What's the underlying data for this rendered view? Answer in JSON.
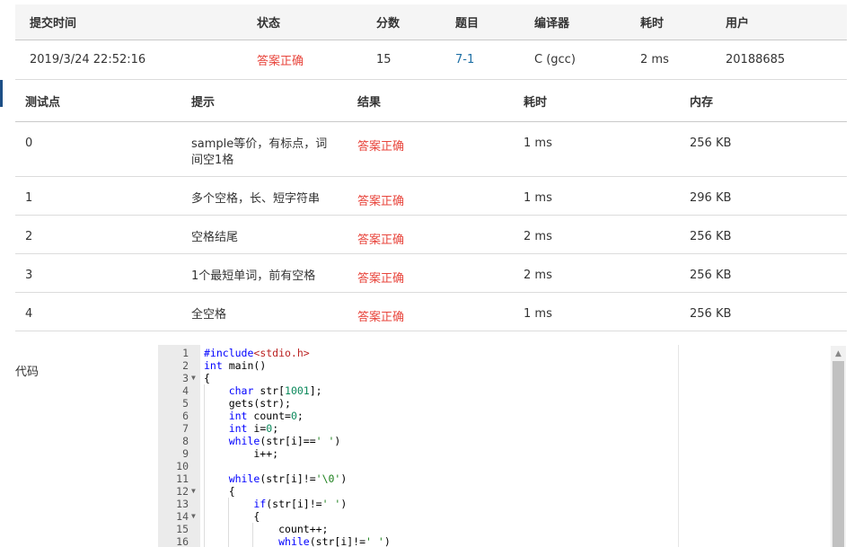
{
  "submission": {
    "headers": [
      "提交时间",
      "状态",
      "分数",
      "题目",
      "编译器",
      "耗时",
      "用户"
    ],
    "row": {
      "time": "2019/3/24 22:52:16",
      "status": "答案正确",
      "score": "15",
      "problem": "7-1",
      "compiler": "C (gcc)",
      "elapsed": "2 ms",
      "user": "20188685"
    }
  },
  "testcases": {
    "headers": [
      "测试点",
      "提示",
      "结果",
      "耗时",
      "内存"
    ],
    "rows": [
      {
        "id": "0",
        "hint": "sample等价，有标点，词间空1格",
        "result": "答案正确",
        "time": "1 ms",
        "mem": "256 KB"
      },
      {
        "id": "1",
        "hint": "多个空格，长、短字符串",
        "result": "答案正确",
        "time": "1 ms",
        "mem": "296 KB"
      },
      {
        "id": "2",
        "hint": "空格结尾",
        "result": "答案正确",
        "time": "2 ms",
        "mem": "256 KB"
      },
      {
        "id": "3",
        "hint": "1个最短单词，前有空格",
        "result": "答案正确",
        "time": "2 ms",
        "mem": "256 KB"
      },
      {
        "id": "4",
        "hint": "全空格",
        "result": "答案正确",
        "time": "1 ms",
        "mem": "256 KB"
      }
    ]
  },
  "code_section": {
    "label": "代码",
    "lines": [
      "#include<stdio.h>",
      "int main()",
      "{",
      "    char str[1001];",
      "    gets(str);",
      "    int count=0;",
      "    int i=0;",
      "    while(str[i]==' ')",
      "        i++;",
      "",
      "    while(str[i]!='\\0')",
      "    {",
      "        if(str[i]!=' ')",
      "        {",
      "            count++;",
      "            while(str[i]!=' ')"
    ],
    "fold_lines": [
      3,
      12,
      14
    ],
    "fold_icon": "fold-arrow-icon"
  },
  "scrollbar": {
    "up_icon": "scroll-up-arrow-icon"
  }
}
